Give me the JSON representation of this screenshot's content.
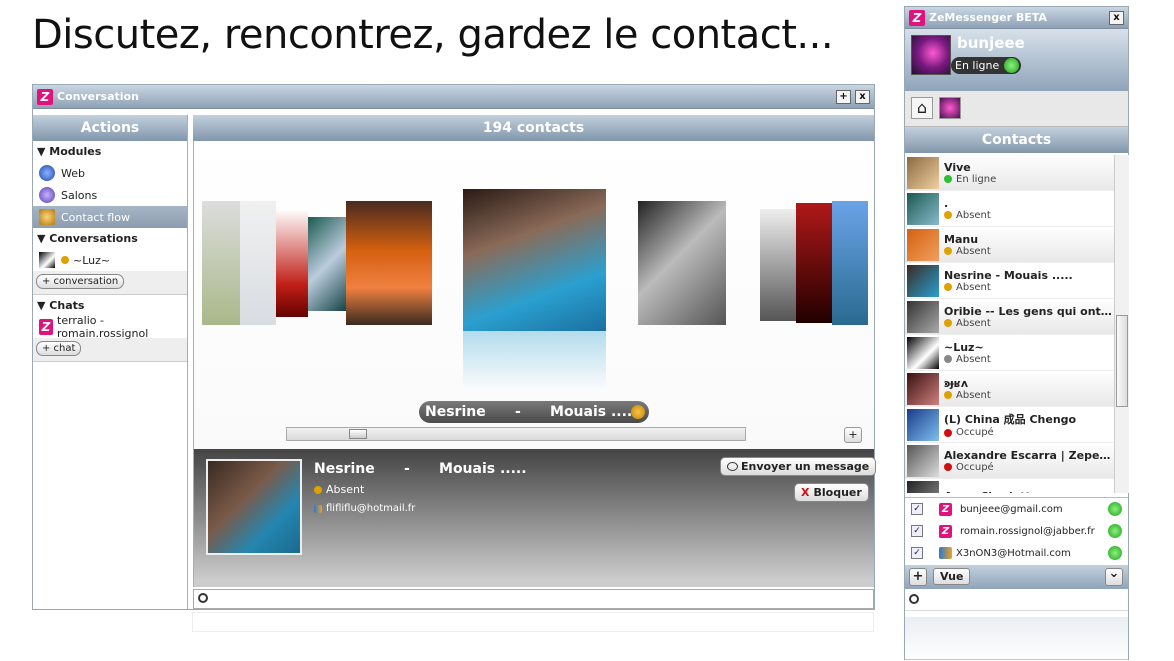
{
  "headline": "Discutez, rencontrez, gardez le contact...",
  "conversation": {
    "title": "Conversation",
    "btn_plus": "+",
    "btn_close": "x",
    "actions_header": "Actions",
    "modules_label": "▼ Modules",
    "web": "Web",
    "salons": "Salons",
    "contact_flow": "Contact flow",
    "conversations_label": "▼ Conversations",
    "conv_item": "~Luz~",
    "add_conversation": "+ conversation",
    "chats_label": "▼ Chats",
    "chat_item": "terralio - romain.rossignol",
    "add_chat": "+ chat",
    "contacts_header": "194 contacts",
    "pill_name": "Nesrine      -      Mouais .....",
    "gallery_plus": "+",
    "detail": {
      "name": "Nesrine      -      Mouais .....",
      "status": "Absent",
      "email": "flifliflu@hotmail.fr",
      "send_message": "Envoyer un message",
      "block": "Bloquer",
      "block_x": "X"
    }
  },
  "messenger": {
    "title": "ZeMessenger BETA",
    "close": "x",
    "user_name": "bunjeee",
    "status": "En ligne",
    "contacts_header": "Contacts",
    "contacts": [
      {
        "name": "Vive",
        "status": "En ligne",
        "color": "#2fbf2f"
      },
      {
        "name": ".",
        "status": "Absent",
        "color": "#e0a000"
      },
      {
        "name": "Manu",
        "status": "Absent",
        "color": "#e0a000"
      },
      {
        "name": "Nesrine       -       Mouais .....",
        "status": "Absent",
        "color": "#e0a000"
      },
      {
        "name": "Oribie -- Les gens qui ont e...",
        "status": "Absent",
        "color": "#e0a000"
      },
      {
        "name": "~Luz~",
        "status": "Absent",
        "color": "#888888"
      },
      {
        "name": "ꜿɟʁʌ",
        "status": "Absent",
        "color": "#e0a000"
      },
      {
        "name": "(L) China 成品 Chengo",
        "status": "Occupé",
        "color": "#d01010"
      },
      {
        "name": "Alexandre Escarra | Zepeo...",
        "status": "Occupé",
        "color": "#d01010"
      },
      {
        "name": "Anne-Charlotte",
        "status": "",
        "color": "#888888"
      }
    ],
    "accounts": [
      {
        "email": "bunjeee@gmail.com"
      },
      {
        "email": "romain.rossignol@jabber.fr"
      },
      {
        "email": "X3nON3@Hotmail.com"
      }
    ],
    "add": "+",
    "vue": "Vue",
    "chevron": "⌄"
  },
  "colors": {
    "brand": "#e1127d",
    "header_blue": "#8fa4ba",
    "absent": "#e0a000",
    "online": "#2fbf2f",
    "busy": "#d01010"
  }
}
